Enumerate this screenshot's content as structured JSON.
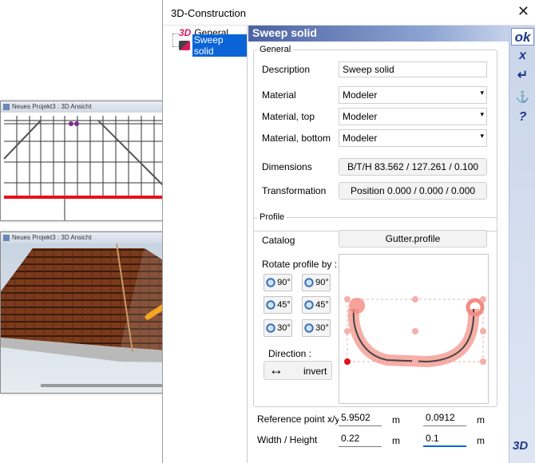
{
  "window": {
    "title": "3D-Construction",
    "close": "✕"
  },
  "tree": {
    "items": [
      {
        "icon": "3D",
        "label": "General"
      },
      {
        "icon": "sweep",
        "label": "Sweep solid"
      }
    ]
  },
  "header": {
    "title": "Sweep solid"
  },
  "general": {
    "legend": "General",
    "description_label": "Description",
    "description_value": "Sweep solid",
    "material_label": "Material",
    "material_value": "Modeler",
    "material_top_label": "Material, top",
    "material_top_value": "Modeler",
    "material_bottom_label": "Material, bottom",
    "material_bottom_value": "Modeler",
    "dimensions_label": "Dimensions",
    "dimensions_value": "B/T/H 83.562 / 127.261 / 0.100",
    "transformation_label": "Transformation",
    "transformation_value": "Position 0.000 / 0.000 / 0.000"
  },
  "profile": {
    "legend": "Profile",
    "catalog_label": "Catalog",
    "catalog_value": "Gutter.profile",
    "rotate_label": "Rotate profile by :",
    "rotate_buttons": [
      "90°",
      "90°",
      "45°",
      "45°",
      "30°",
      "30°"
    ],
    "direction_label": "Direction :",
    "invert_label": "invert",
    "invert_icon": "↔"
  },
  "reference": {
    "label": "Reference point x/y",
    "x": "5.9502",
    "y": "0.0912",
    "unit": "m"
  },
  "size": {
    "label": "Width / Height",
    "width": "0.22",
    "height": "0.1",
    "unit": "m"
  },
  "sidebar": {
    "ok": "ok",
    "cancel": "x",
    "enter": "↵",
    "anchor": "⚓",
    "help": "?",
    "view3d": "3D"
  },
  "windows": {
    "top_title": "Neues Projekt3 : 3D Ansicht",
    "bottom_title": "Neues Projekt3 : 3D Ansicht"
  },
  "colors": {
    "accent": "#f5a623",
    "header": "#4b62a3",
    "highlight": "#0a64d8"
  }
}
